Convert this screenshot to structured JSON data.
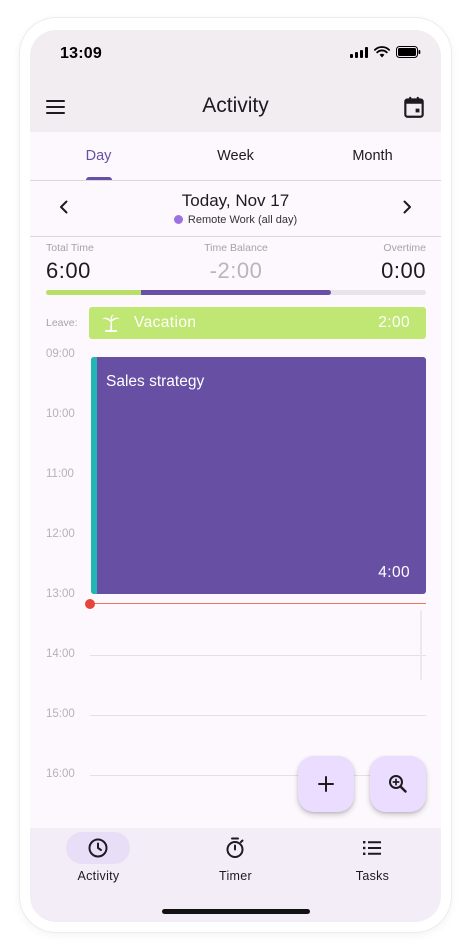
{
  "status_bar": {
    "time": "13:09"
  },
  "app_bar": {
    "title": "Activity",
    "menu_icon": "menu-icon",
    "calendar_icon": "calendar-icon"
  },
  "tabs": [
    {
      "label": "Day",
      "active": true
    },
    {
      "label": "Week",
      "active": false
    },
    {
      "label": "Month",
      "active": false
    }
  ],
  "date_nav": {
    "title": "Today, Nov 17",
    "subtitle": "Remote Work (all day)",
    "subtitle_dot_color": "#9b72e0"
  },
  "summary": {
    "total_time": {
      "label": "Total Time",
      "value": "6:00"
    },
    "time_balance": {
      "label": "Time Balance",
      "value": "-2:00"
    },
    "overtime": {
      "label": "Overtime",
      "value": "0:00"
    },
    "progress": {
      "leave_fraction": 0.25,
      "work_fraction": 0.75
    }
  },
  "leave": {
    "label": "Leave:",
    "name": "Vacation",
    "duration": "2:00",
    "icon": "palm-tree-icon",
    "color": "#c0e774"
  },
  "timeline": {
    "hours": [
      "09:00",
      "10:00",
      "11:00",
      "12:00",
      "13:00",
      "14:00",
      "15:00",
      "16:00"
    ],
    "event": {
      "title": "Sales strategy",
      "duration": "4:00",
      "color": "#6750a4",
      "stripe_color": "#22b6b4"
    },
    "now_indicator_color": "#e8453a"
  },
  "fabs": {
    "add_icon": "plus-icon",
    "zoom_icon": "zoom-in-icon"
  },
  "bottom_nav": [
    {
      "label": "Activity",
      "icon": "clock-icon",
      "active": true
    },
    {
      "label": "Timer",
      "icon": "stopwatch-icon",
      "active": false
    },
    {
      "label": "Tasks",
      "icon": "list-icon",
      "active": false
    }
  ],
  "accent_color": "#6750a4"
}
